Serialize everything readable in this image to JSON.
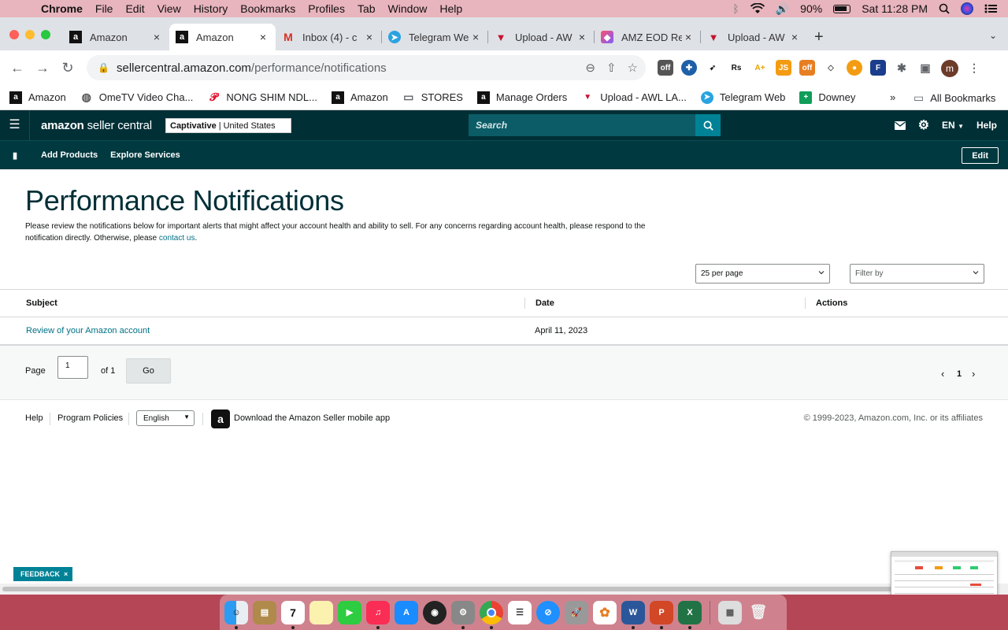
{
  "mac_menubar": {
    "app_name": "Chrome",
    "menus": [
      "File",
      "Edit",
      "View",
      "History",
      "Bookmarks",
      "Profiles",
      "Tab",
      "Window",
      "Help"
    ],
    "battery": "90%",
    "clock": "Sat 11:28 PM"
  },
  "browser": {
    "tabs": [
      {
        "title": "Amazon",
        "favicon": "amazon-a",
        "active": false
      },
      {
        "title": "Amazon",
        "favicon": "amazon-a",
        "active": true
      },
      {
        "title": "Inbox (4) - c",
        "favicon": "gmail-m",
        "active": false
      },
      {
        "title": "Telegram We",
        "favicon": "telegram",
        "active": false
      },
      {
        "title": "Upload - AW",
        "favicon": "awl-v",
        "active": false
      },
      {
        "title": "AMZ EOD Re",
        "favicon": "clickup",
        "active": false
      },
      {
        "title": "Upload - AW",
        "favicon": "awl-v",
        "active": false
      }
    ],
    "url_host": "sellercentral.amazon.com",
    "url_path": "/performance/notifications",
    "profile_initial": "m",
    "bookmarks": [
      {
        "label": "Amazon",
        "icon": "amazon-a"
      },
      {
        "label": "OmeTV Video Cha...",
        "icon": "globe"
      },
      {
        "label": "NONG SHIM NDL...",
        "icon": "pinterest"
      },
      {
        "label": "Amazon",
        "icon": "amazon-a"
      },
      {
        "label": "STORES",
        "icon": "folder"
      },
      {
        "label": "Manage Orders",
        "icon": "amazon-a"
      },
      {
        "label": "Upload - AWL LA...",
        "icon": "awl-v"
      },
      {
        "label": "Telegram Web",
        "icon": "telegram"
      },
      {
        "label": "Downey",
        "icon": "sheets"
      }
    ],
    "bookmarks_more": "»",
    "all_bookmarks": "All Bookmarks"
  },
  "seller_central": {
    "logo_main": "amazon",
    "logo_sub": "seller central",
    "store_name": "Captivative",
    "store_region": "| United States",
    "search_placeholder": "Search",
    "language": "EN",
    "help": "Help",
    "subnav": [
      "Add Products",
      "Explore Services"
    ],
    "edit": "Edit"
  },
  "page": {
    "title": "Performance Notifications",
    "description": "Please review the notifications below for important alerts that might affect your account health and ability to sell. For any concerns regarding account health, please respond to the notification directly. Otherwise, please ",
    "contact_link": "contact us",
    "description_end": ".",
    "per_page": "25 per page",
    "filter_by": "Filter by",
    "columns": [
      "Subject",
      "Date",
      "Actions"
    ],
    "rows": [
      {
        "subject": "Review of your Amazon account",
        "date": "April 11, 2023"
      }
    ],
    "pager": {
      "label": "Page",
      "current": "1",
      "of": "of 1",
      "go": "Go",
      "page_number": "1"
    }
  },
  "footer": {
    "help": "Help",
    "program_policies": "Program Policies",
    "language": "English",
    "app_download": "Download the Amazon Seller mobile app",
    "copyright": "© 1999-2023, Amazon.com, Inc. or its affiliates"
  },
  "feedback": "FEEDBACK",
  "colors": {
    "sc_header": "#002f36",
    "sc_link": "#007185",
    "search_button": "#008296",
    "menubar": "#e8b4bd"
  }
}
